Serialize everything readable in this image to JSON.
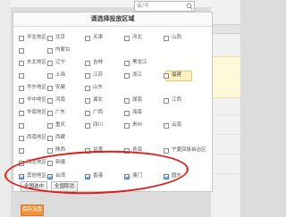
{
  "search": {
    "placeholder": "省/市"
  },
  "dialog": {
    "title": "请选择投放区域"
  },
  "regions": [
    {
      "group": "华北地区",
      "items": [
        "北京",
        "天津",
        "河北",
        "山西"
      ]
    },
    {
      "group": "",
      "items": [
        "内蒙古"
      ]
    },
    {
      "group": "东北地区",
      "items": [
        "辽宁",
        "吉林",
        "黑龙江"
      ]
    },
    {
      "group": "",
      "items": [
        "上海",
        "江苏",
        "浙江",
        "福建"
      ]
    },
    {
      "group": "华东地区",
      "items": [
        "安徽",
        "山东"
      ]
    },
    {
      "group": "华中地区",
      "items": [
        "河南",
        "湖北",
        "湖南",
        "江西"
      ]
    },
    {
      "group": "华南地区",
      "items": [
        "广东",
        "广西",
        "海南"
      ]
    },
    {
      "group": "",
      "items": [
        "重庆",
        "四川",
        "贵州",
        "云南"
      ]
    },
    {
      "group": "西南地区",
      "items": [
        "西藏"
      ]
    },
    {
      "group": "",
      "items": [
        "陕西",
        "甘肃",
        "青海",
        "宁夏回族自治区"
      ]
    },
    {
      "group": "西北地区",
      "items": [
        "新疆"
      ]
    },
    {
      "group": "其他地区",
      "items": [
        "台湾",
        "香港",
        "澳门",
        "国外"
      ]
    }
  ],
  "selected_region": "福建",
  "buttons": {
    "select_all": "全国选中",
    "deselect_all": "全国取消",
    "save": "保存设置"
  },
  "colors": {
    "save_button": "#f0933a",
    "annotation": "#e01b1b",
    "highlight": "#fff3c4"
  }
}
